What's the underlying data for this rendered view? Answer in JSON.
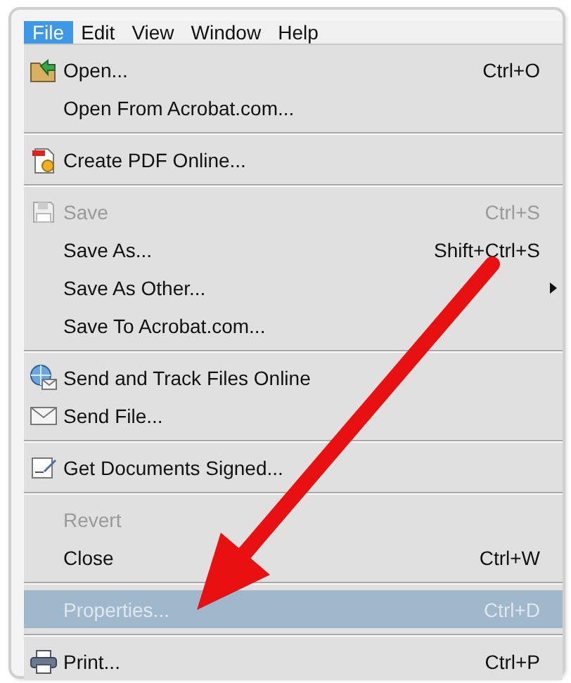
{
  "menubar": [
    {
      "label": "File",
      "selected": true
    },
    {
      "label": "Edit",
      "selected": false
    },
    {
      "label": "View",
      "selected": false
    },
    {
      "label": "Window",
      "selected": false
    },
    {
      "label": "Help",
      "selected": false
    }
  ],
  "menu": [
    {
      "kind": "item",
      "label": "Open...",
      "shortcut": "Ctrl+O",
      "disabled": false,
      "selected": false,
      "submenu": false
    },
    {
      "kind": "item",
      "label": "Open From Acrobat.com...",
      "disabled": false,
      "selected": false,
      "submenu": false
    },
    {
      "kind": "separator"
    },
    {
      "kind": "item",
      "label": "Create PDF Online...",
      "disabled": false,
      "selected": false,
      "submenu": false
    },
    {
      "kind": "separator"
    },
    {
      "kind": "item",
      "label": "Save",
      "shortcut": "Ctrl+S",
      "disabled": true,
      "selected": false,
      "submenu": false
    },
    {
      "kind": "item",
      "label": "Save As...",
      "shortcut": "Shift+Ctrl+S",
      "disabled": false,
      "selected": false,
      "submenu": false
    },
    {
      "kind": "item",
      "label": "Save As Other...",
      "disabled": false,
      "selected": false,
      "submenu": true
    },
    {
      "kind": "item",
      "label": "Save To Acrobat.com...",
      "disabled": false,
      "selected": false,
      "submenu": false
    },
    {
      "kind": "separator"
    },
    {
      "kind": "item",
      "label": "Send and Track Files Online",
      "disabled": false,
      "selected": false,
      "submenu": false
    },
    {
      "kind": "item",
      "label": "Send File...",
      "disabled": false,
      "selected": false,
      "submenu": false
    },
    {
      "kind": "separator"
    },
    {
      "kind": "item",
      "label": "Get Documents Signed...",
      "disabled": false,
      "selected": false,
      "submenu": false
    },
    {
      "kind": "separator"
    },
    {
      "kind": "item",
      "label": "Revert",
      "disabled": true,
      "selected": false,
      "submenu": false
    },
    {
      "kind": "item",
      "label": "Close",
      "shortcut": "Ctrl+W",
      "disabled": false,
      "selected": false,
      "submenu": false
    },
    {
      "kind": "separator"
    },
    {
      "kind": "item",
      "label": "Properties...",
      "shortcut": "Ctrl+D",
      "disabled": true,
      "selected": true,
      "submenu": false
    },
    {
      "kind": "separator"
    },
    {
      "kind": "item",
      "label": "Print...",
      "shortcut": "Ctrl+P",
      "disabled": false,
      "selected": false,
      "submenu": false
    }
  ]
}
